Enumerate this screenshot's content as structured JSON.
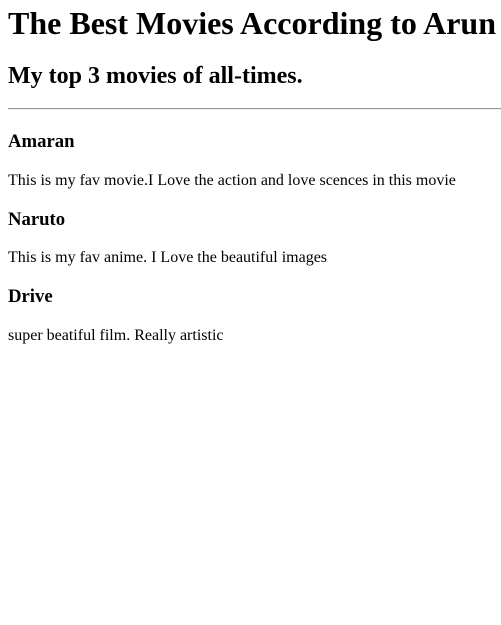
{
  "header": {
    "title": "The Best Movies According to Arun",
    "subtitle": "My top 3 movies of all-times."
  },
  "movies": [
    {
      "title": "Amaran",
      "description": "This is my fav movie.I Love the action and love scences in this movie"
    },
    {
      "title": "Naruto",
      "description": "This is my fav anime. I Love the beautiful images"
    },
    {
      "title": "Drive",
      "description": "super beatiful film. Really artistic"
    }
  ]
}
